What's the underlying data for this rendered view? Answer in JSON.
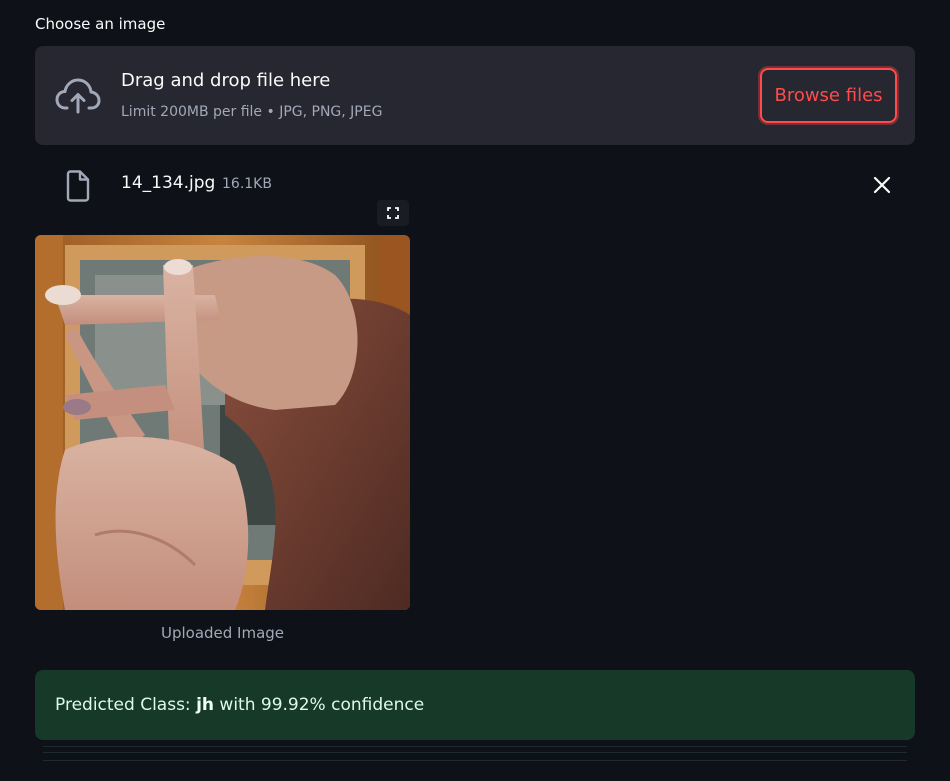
{
  "uploader": {
    "label": "Choose an image",
    "dropzone_title": "Drag and drop file here",
    "dropzone_subtitle": "Limit 200MB per file • JPG, PNG, JPEG",
    "browse_label": "Browse files",
    "icon": "cloud-upload-icon"
  },
  "file": {
    "name": "14_134.jpg",
    "size": "16.1KB",
    "icon": "file-icon"
  },
  "image": {
    "caption": "Uploaded Image"
  },
  "result": {
    "prefix": "Predicted Class:",
    "class_name": "jh",
    "suffix": "with 99.92% confidence"
  },
  "colors": {
    "background": "#0e1117",
    "dropzone": "#262730",
    "accent": "#ff4b4b",
    "success_bg": "#173928"
  }
}
